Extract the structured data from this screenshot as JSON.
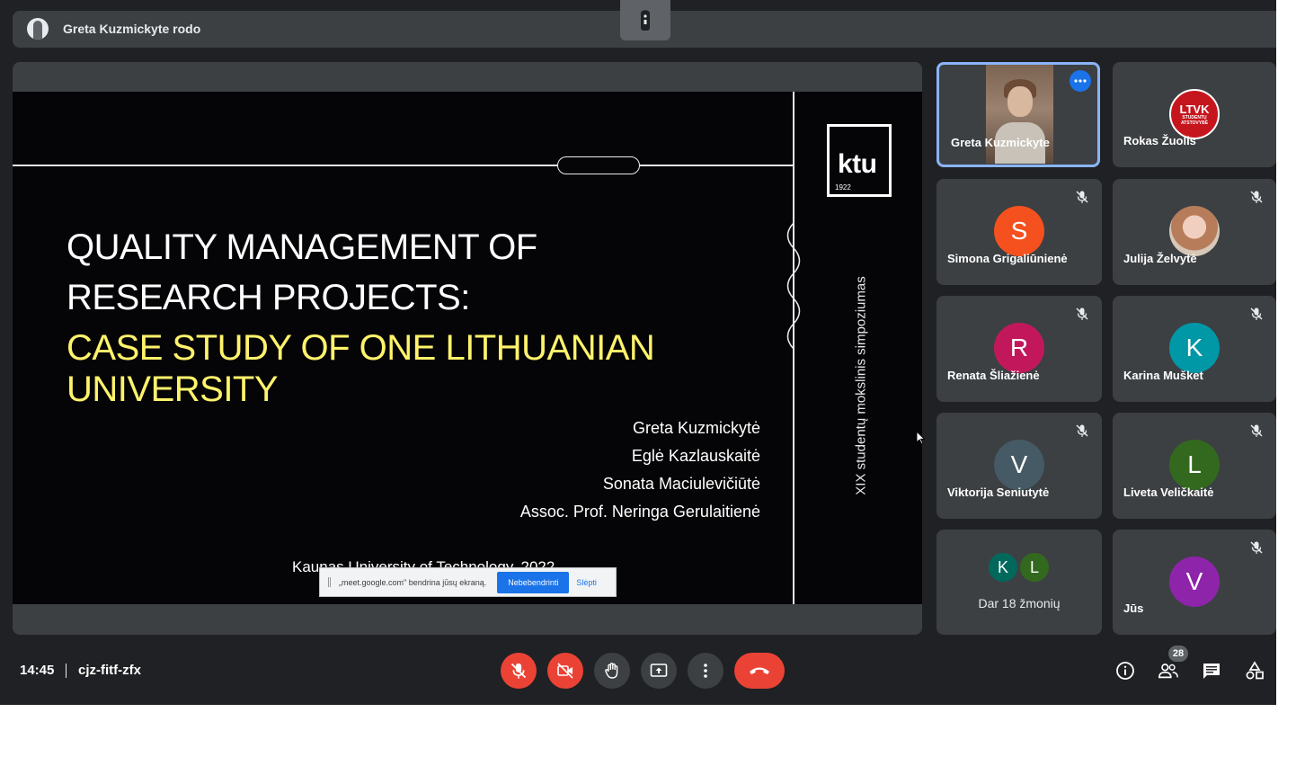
{
  "presenter_bar": {
    "text": "Greta Kuzmickyte rodo"
  },
  "slide": {
    "title_line1": "QUALITY MANAGEMENT OF",
    "title_line2": "RESEARCH PROJECTS:",
    "subtitle_line1": "CASE STUDY OF ONE LITHUANIAN",
    "subtitle_line2": "UNIVERSITY",
    "authors": [
      "Greta Kuzmickytė",
      "Eglė Kazlauskaitė",
      "Sonata Maciulevičiūtė",
      "Assoc. Prof. Neringa Gerulaitienė"
    ],
    "footer": "Kaunas University of Technology, 2022",
    "logo_text": "ktu",
    "logo_year": "1922",
    "vertical_text": "XIX studentų mokslinis simpoziumas"
  },
  "share_notice": {
    "text": "„meet.google.com\" bendrina jūsų ekraną.",
    "stop_label": "Nebebendrinti",
    "hide_label": "Slėpti"
  },
  "participants": [
    {
      "name": "Greta Kuzmickyte",
      "type": "video",
      "muted": false
    },
    {
      "name": "Rokas Žuolis",
      "type": "logo",
      "logo_text": "LTVK",
      "logo_sub": "STUDENTŲ ATSTOVYBĖ",
      "muted": false
    },
    {
      "name": "Simona Grigaliūnienė",
      "initial": "S",
      "color": "#f4511e",
      "muted": true
    },
    {
      "name": "Julija Želvytė",
      "type": "photo",
      "muted": true
    },
    {
      "name": "Renata Šliažienė",
      "initial": "R",
      "color": "#c2185b",
      "muted": true
    },
    {
      "name": "Karina Mušket",
      "initial": "K",
      "color": "#0097a7",
      "muted": true
    },
    {
      "name": "Viktorija Seniutytė",
      "initial": "V",
      "color": "#455a64",
      "muted": true
    },
    {
      "name": "Liveta Veličkaitė",
      "initial": "L",
      "color": "#33691e",
      "muted": true
    },
    {
      "name": "Jūs",
      "initial": "V",
      "color": "#8e24aa",
      "muted": true
    }
  ],
  "others_tile": {
    "label": "Dar 18 žmonių",
    "avatars": [
      {
        "initial": "K",
        "color": "#00695c"
      },
      {
        "initial": "L",
        "color": "#33691e"
      }
    ]
  },
  "bottom_bar": {
    "time": "14:45",
    "meeting_code": "cjz-fitf-zfx",
    "people_count": "28"
  },
  "icons": {
    "mic": "mic-off-icon",
    "camera": "videocam-off-icon",
    "hand": "raise-hand-icon",
    "present": "present-screen-icon",
    "more": "more-vert-icon",
    "leave": "call-end-icon",
    "info": "info-icon",
    "people": "people-icon",
    "chat": "chat-icon",
    "activities": "activities-icon"
  },
  "colors": {
    "background": "#202124",
    "tile": "#3c4043",
    "danger": "#ea4335",
    "accent": "#8ab4f8",
    "slide_highlight": "#fff36b"
  }
}
